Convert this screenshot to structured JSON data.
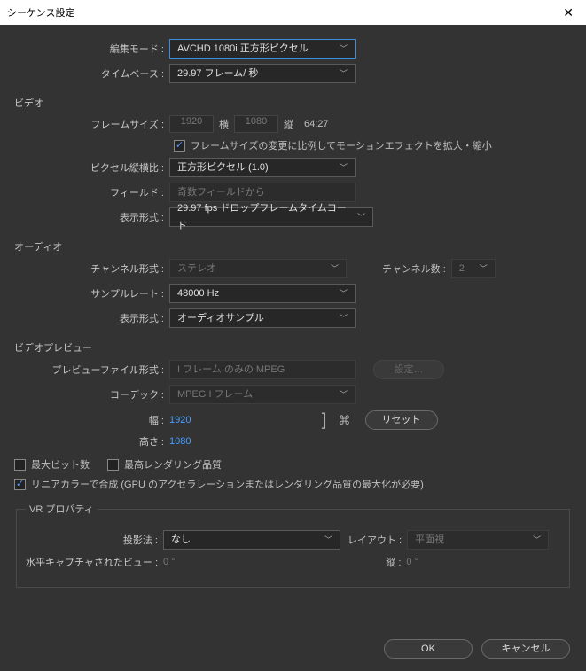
{
  "title": "シーケンス設定",
  "editMode": {
    "label": "編集モード :",
    "value": "AVCHD 1080i 正方形ピクセル"
  },
  "timebase": {
    "label": "タイムベース :",
    "value": "29.97 フレーム/ 秒"
  },
  "videoSection": "ビデオ",
  "frameSize": {
    "label": "フレームサイズ :",
    "width": "1920",
    "wLabel": "横",
    "height": "1080",
    "hLabel": "縦",
    "aspect": "64:27"
  },
  "scaleCheck": "フレームサイズの変更に比例してモーションエフェクトを拡大・縮小",
  "pixelAspect": {
    "label": "ピクセル縦横比 :",
    "value": "正方形ピクセル (1.0)"
  },
  "field": {
    "label": "フィールド :",
    "value": "奇数フィールドから"
  },
  "vDisplay": {
    "label": "表示形式 :",
    "value": "29.97 fps ドロップフレームタイムコード"
  },
  "audioSection": "オーディオ",
  "channelFormat": {
    "label": "チャンネル形式 :",
    "value": "ステレオ"
  },
  "channelCount": {
    "label": "チャンネル数 :",
    "value": "2"
  },
  "sampleRate": {
    "label": "サンプルレート :",
    "value": "48000 Hz"
  },
  "aDisplay": {
    "label": "表示形式 :",
    "value": "オーディオサンプル"
  },
  "previewSection": "ビデオプレビュー",
  "previewFile": {
    "label": "プレビューファイル形式 :",
    "value": "I フレーム のみの MPEG"
  },
  "configBtn": "設定…",
  "codec": {
    "label": "コーデック :",
    "value": "MPEG I フレーム"
  },
  "pWidth": {
    "label": "幅 :",
    "value": "1920"
  },
  "pHeight": {
    "label": "高さ :",
    "value": "1080"
  },
  "resetBtn": "リセット",
  "maxBit": "最大ビット数",
  "maxRender": "最高レンダリング品質",
  "linearColor": "リニアカラーで合成 (GPU のアクセラレーションまたはレンダリング品質の最大化が必要)",
  "vrSection": "VR プロパティ",
  "projection": {
    "label": "投影法 :",
    "value": "なし"
  },
  "layout": {
    "label": "レイアウト :",
    "value": "平面視"
  },
  "horizCap": {
    "label": "水平キャプチャされたビュー :",
    "value": "0 °"
  },
  "vert": {
    "label": "縦 :",
    "value": "0 °"
  },
  "ok": "OK",
  "cancel": "キャンセル"
}
